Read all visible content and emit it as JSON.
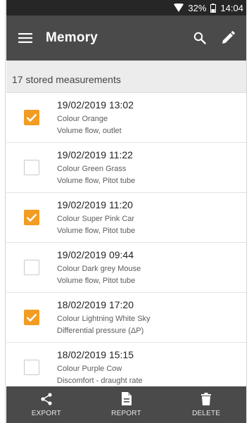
{
  "status_bar": {
    "battery_text": "32%",
    "time": "14:04",
    "icons": [
      "wifi-icon",
      "battery-icon"
    ]
  },
  "app_bar": {
    "title": "Memory",
    "icons": [
      "menu-icon",
      "search-icon",
      "pencil-icon"
    ]
  },
  "subheader": {
    "count_text": "17 stored measurements"
  },
  "colors": {
    "accent": "#f39c23",
    "bar": "#4a4a4a",
    "status_bar": "#262626"
  },
  "measurements": [
    {
      "datetime": "19/02/2019 13:02",
      "name": "Colour Orange",
      "type": "Volume flow, outlet",
      "checked": true
    },
    {
      "datetime": "19/02/2019 11:22",
      "name": "Colour Green Grass",
      "type": "Volume flow, Pitot tube",
      "checked": false
    },
    {
      "datetime": "19/02/2019 11:20",
      "name": "Colour Super Pink Car",
      "type": "Volume flow, Pitot tube",
      "checked": true
    },
    {
      "datetime": "19/02/2019 09:44",
      "name": "Colour Dark grey Mouse",
      "type": "Volume flow, Pitot tube",
      "checked": false
    },
    {
      "datetime": "18/02/2019 17:20",
      "name": "Colour Lightning White Sky",
      "type": "Differential pressure (ΔP)",
      "checked": true
    },
    {
      "datetime": "18/02/2019 15:15",
      "name": "Colour Purple Cow",
      "type": "Discomfort - draught rate",
      "checked": false
    }
  ],
  "bottom_bar": {
    "export_label": "EXPORT",
    "report_label": "REPORT",
    "delete_label": "DELETE",
    "icons": [
      "share-icon",
      "document-icon",
      "trash-icon"
    ]
  }
}
